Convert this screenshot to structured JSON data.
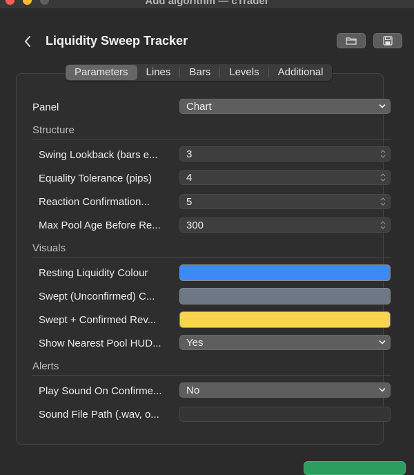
{
  "window": {
    "title": "Add algorithm — cTrader"
  },
  "header": {
    "title": "Liquidity Sweep Tracker",
    "back_icon": "chevron-left-icon",
    "open_icon": "folder-icon",
    "save_icon": "save-icon"
  },
  "tabs": [
    {
      "label": "Parameters",
      "selected": true
    },
    {
      "label": "Lines"
    },
    {
      "label": "Bars"
    },
    {
      "label": "Levels"
    },
    {
      "label": "Additional"
    }
  ],
  "panel_row": {
    "label": "Panel",
    "value": "Chart"
  },
  "sections": {
    "structure": {
      "title": "Structure",
      "rows": [
        {
          "label": "Swing Lookback (bars e...",
          "value": "3"
        },
        {
          "label": "Equality Tolerance (pips)",
          "value": "4"
        },
        {
          "label": "Reaction Confirmation...",
          "value": "5"
        },
        {
          "label": "Max Pool Age Before Re...",
          "value": "300"
        }
      ]
    },
    "visuals": {
      "title": "Visuals",
      "rows": [
        {
          "label": "Resting Liquidity Colour",
          "color": "#3d8af7"
        },
        {
          "label": "Swept (Unconfirmed) C...",
          "color": "#6d7785"
        },
        {
          "label": "Swept + Confirmed Rev...",
          "color": "#f7d54f"
        },
        {
          "label": "Show Nearest Pool HUD...",
          "value": "Yes"
        }
      ]
    },
    "alerts": {
      "title": "Alerts",
      "rows": [
        {
          "label": "Play Sound On Confirme...",
          "value": "No"
        },
        {
          "label": "Sound File Path (.wav, o...",
          "value": ""
        }
      ]
    }
  },
  "colors": {
    "accent_green": "#2e9c5e"
  }
}
